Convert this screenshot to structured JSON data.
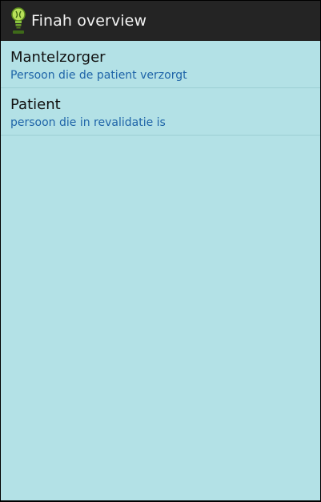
{
  "app": {
    "title": "Finah overview",
    "icon": "lightbulb-logo-icon"
  },
  "list": {
    "items": [
      {
        "title": "Mantelzorger",
        "subtitle": "Persoon die de patient verzorgt"
      },
      {
        "title": "Patient",
        "subtitle": "persoon die in revalidatie is"
      }
    ]
  },
  "colors": {
    "actionbar": "#242424",
    "background": "#b3e1e6",
    "subtitle_text": "#1e64a8",
    "icon_green": "#8bc53f"
  }
}
